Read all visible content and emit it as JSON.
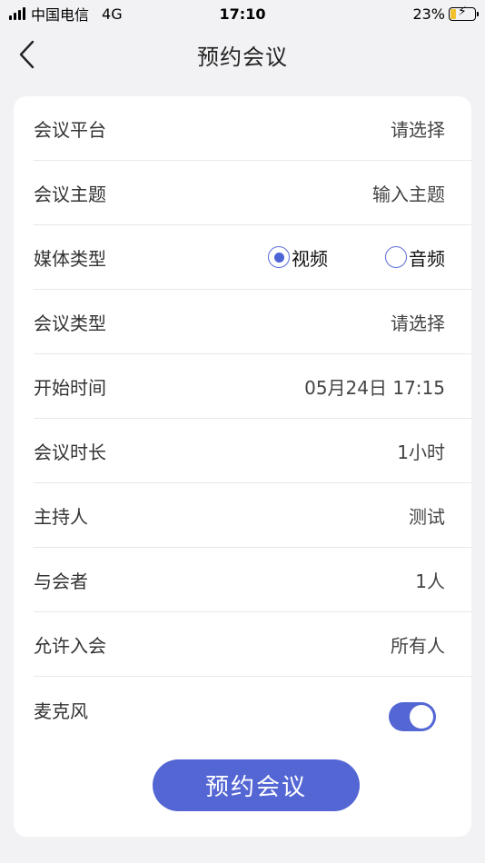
{
  "status_bar": {
    "carrier": "中国电信",
    "network": "4G",
    "time": "17:10",
    "battery_percent": "23%",
    "battery_level": 0.23
  },
  "nav": {
    "title": "预约会议",
    "back_icon": "chevron-left-icon"
  },
  "form": {
    "platform": {
      "label": "会议平台",
      "value": "请选择"
    },
    "topic": {
      "label": "会议主题",
      "value": "输入主题"
    },
    "media_type": {
      "label": "媒体类型",
      "options": [
        {
          "label": "视频",
          "selected": true
        },
        {
          "label": "音频",
          "selected": false
        }
      ]
    },
    "meeting_type": {
      "label": "会议类型",
      "value": "请选择"
    },
    "start_time": {
      "label": "开始时间",
      "value": "05月24日 17:15"
    },
    "duration": {
      "label": "会议时长",
      "value": "1小时"
    },
    "host": {
      "label": "主持人",
      "value": "测试"
    },
    "participants": {
      "label": "与会者",
      "value": "1人"
    },
    "allow_join": {
      "label": "允许入会",
      "value": "所有人"
    },
    "microphone": {
      "label": "麦克风",
      "enabled": true
    }
  },
  "submit_label": "预约会议",
  "colors": {
    "accent": "#5466d4",
    "background": "#f2f2f4",
    "card": "#ffffff"
  }
}
